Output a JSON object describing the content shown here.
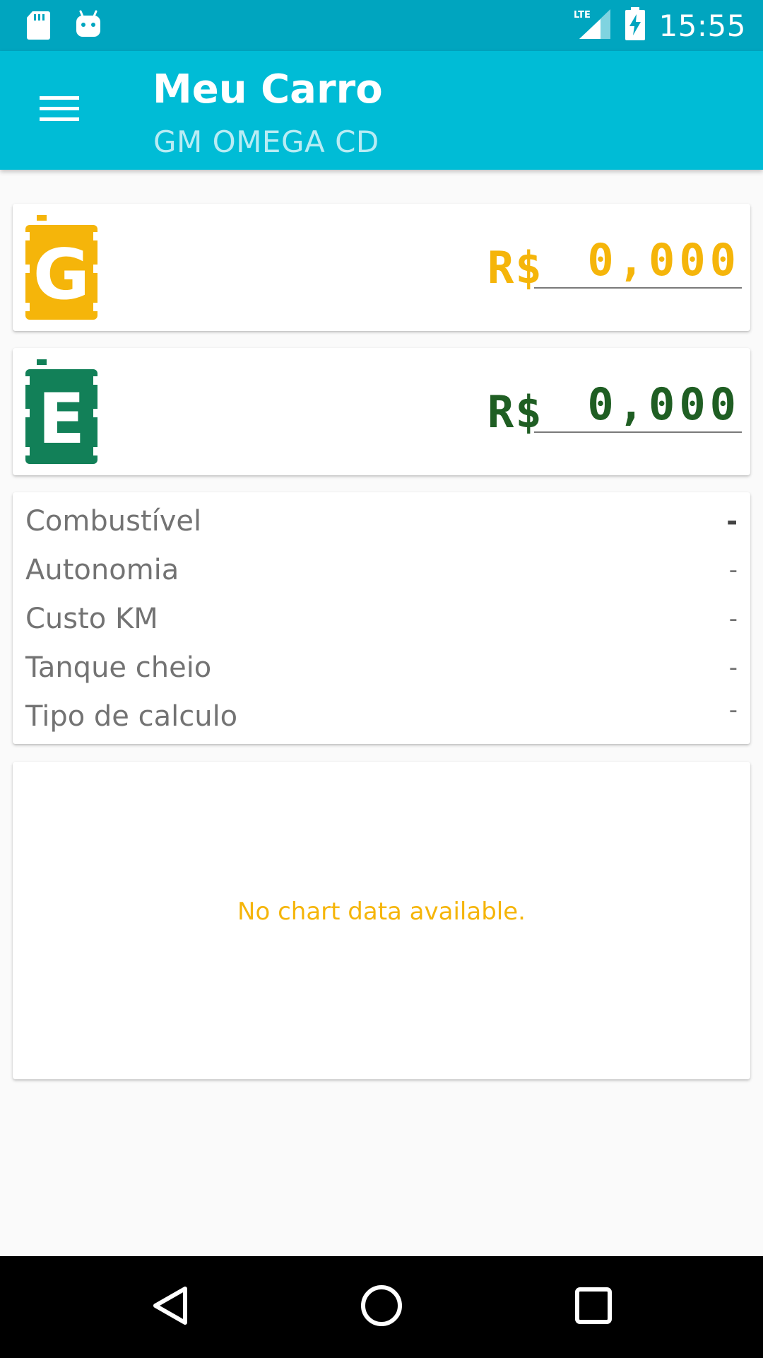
{
  "status_bar": {
    "time": "15:55",
    "network": "LTE"
  },
  "app_bar": {
    "title": "Meu Carro",
    "subtitle": "GM OMEGA CD"
  },
  "fuels": {
    "gasoline": {
      "letter": "G",
      "currency": "R$",
      "price": "0,000",
      "color": "#f5b50a"
    },
    "ethanol": {
      "letter": "E",
      "currency": "R$",
      "price": "0,000",
      "color": "#1f5e23"
    }
  },
  "info": {
    "rows": [
      {
        "label": "Combustível",
        "value": "-"
      },
      {
        "label": "Autonomia",
        "value": "-"
      },
      {
        "label": "Custo KM",
        "value": "-"
      },
      {
        "label": "Tanque cheio",
        "value": "-"
      },
      {
        "label": "Tipo de calculo",
        "value": "-"
      }
    ]
  },
  "chart": {
    "empty_message": "No chart data available."
  },
  "colors": {
    "primary": "#00bcd6",
    "primary_dark": "#00a5bf",
    "gasoline": "#f5b50a",
    "ethanol": "#1f5e23"
  }
}
